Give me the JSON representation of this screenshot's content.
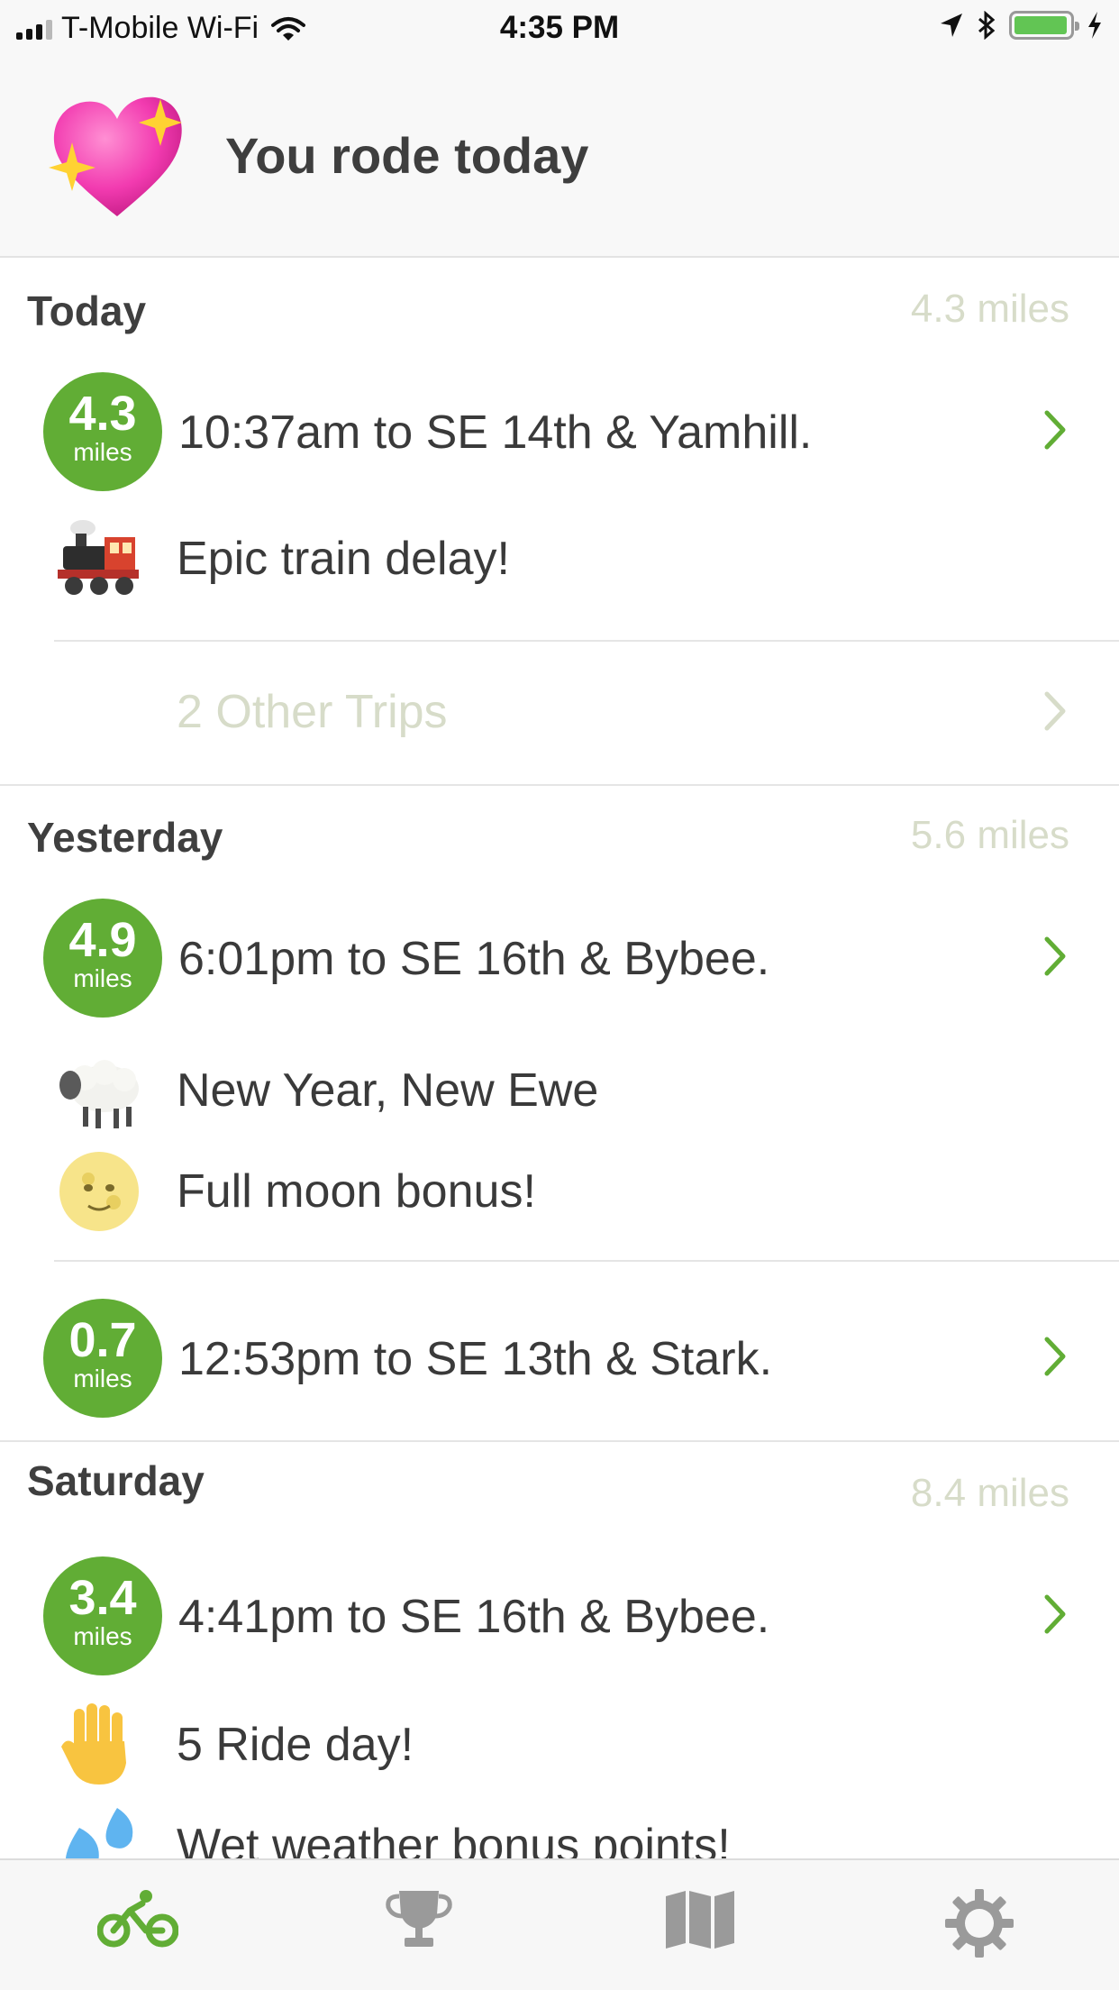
{
  "status_bar": {
    "carrier": "T-Mobile Wi-Fi",
    "time": "4:35 PM",
    "icons": [
      "signal-icon",
      "wifi-icon",
      "location-arrow-icon",
      "bluetooth-icon",
      "battery-icon",
      "charging-bolt-icon"
    ]
  },
  "header": {
    "emoji": "sparkling-heart",
    "title": "You rode today"
  },
  "sections": [
    {
      "day": "Today",
      "total": "4.3 miles",
      "trips": [
        {
          "miles": "4.3",
          "unit": "miles",
          "description": "10:37am to SE 14th & Yamhill.",
          "notes": [
            {
              "emoji": "steam-locomotive",
              "text": "Epic train delay!"
            }
          ]
        }
      ],
      "other_trips": "2 Other Trips"
    },
    {
      "day": "Yesterday",
      "total": "5.6 miles",
      "trips": [
        {
          "miles": "4.9",
          "unit": "miles",
          "description": "6:01pm to SE 16th & Bybee.",
          "notes": [
            {
              "emoji": "sheep",
              "text": "New Year, New Ewe"
            },
            {
              "emoji": "full-moon-face",
              "text": "Full moon bonus!"
            }
          ]
        },
        {
          "miles": "0.7",
          "unit": "miles",
          "description": "12:53pm to SE 13th & Stark.",
          "notes": []
        }
      ]
    },
    {
      "day": "Saturday",
      "total": "8.4 miles",
      "trips": [
        {
          "miles": "3.4",
          "unit": "miles",
          "description": "4:41pm to SE 16th & Bybee.",
          "notes": [
            {
              "emoji": "raised-hand",
              "text": "5 Ride day!"
            },
            {
              "emoji": "sweat-droplets",
              "text": "Wet weather bonus points!"
            }
          ]
        }
      ]
    }
  ],
  "tab_bar": {
    "tabs": [
      {
        "icon": "bicycle-icon",
        "active": true
      },
      {
        "icon": "trophy-icon",
        "active": false
      },
      {
        "icon": "map-icon",
        "active": false
      },
      {
        "icon": "gear-icon",
        "active": false
      }
    ],
    "active_color": "#61ad35",
    "inactive_color": "#9a9a9a"
  },
  "colors": {
    "accent_green": "#61ad35",
    "muted_text": "#d7dcc9",
    "primary_text": "#3a3a3a"
  }
}
